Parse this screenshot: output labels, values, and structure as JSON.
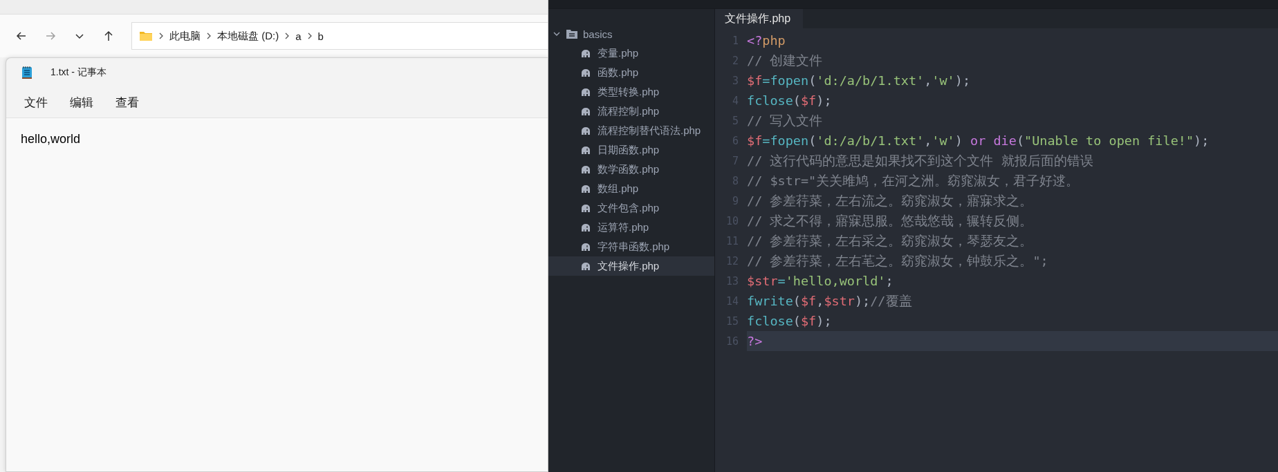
{
  "explorer": {
    "nav": [
      {
        "kind": "back",
        "disabled": false
      },
      {
        "kind": "forward",
        "disabled": true
      },
      {
        "kind": "recent",
        "disabled": false
      },
      {
        "kind": "up",
        "disabled": false
      }
    ],
    "breadcrumb": [
      "此电脑",
      "本地磁盘 (D:)",
      "a",
      "b"
    ]
  },
  "notepad": {
    "title": "1.txt - 记事本",
    "menu": [
      "文件",
      "编辑",
      "查看"
    ],
    "content": "hello,world"
  },
  "editor": {
    "tree": {
      "name": "basics",
      "expanded": true,
      "children": [
        {
          "name": "变量.php",
          "selected": false
        },
        {
          "name": "函数.php",
          "selected": false
        },
        {
          "name": "类型转换.php",
          "selected": false
        },
        {
          "name": "流程控制.php",
          "selected": false
        },
        {
          "name": "流程控制替代语法.php",
          "selected": false
        },
        {
          "name": "日期函数.php",
          "selected": false
        },
        {
          "name": "数学函数.php",
          "selected": false
        },
        {
          "name": "数组.php",
          "selected": false
        },
        {
          "name": "文件包含.php",
          "selected": false
        },
        {
          "name": "运算符.php",
          "selected": false
        },
        {
          "name": "字符串函数.php",
          "selected": false
        },
        {
          "name": "文件操作.php",
          "selected": true
        }
      ]
    },
    "tabs": [
      {
        "label": "文件操作.php",
        "selected": true
      }
    ],
    "lines": [
      {
        "number": "1",
        "current": false,
        "tokens": [
          {
            "kind": "tag",
            "text": "<?"
          },
          {
            "kind": "keyword",
            "text": "php"
          }
        ]
      },
      {
        "number": "2",
        "current": false,
        "tokens": [
          {
            "kind": "comment",
            "text": "// 创建文件"
          }
        ]
      },
      {
        "number": "3",
        "current": false,
        "tokens": [
          {
            "kind": "variable",
            "text": "$f"
          },
          {
            "kind": "operator",
            "text": "="
          },
          {
            "kind": "function",
            "text": "fopen"
          },
          {
            "kind": "plain",
            "text": "("
          },
          {
            "kind": "string",
            "text": "'d:/a/b/1.txt'"
          },
          {
            "kind": "plain",
            "text": ","
          },
          {
            "kind": "string",
            "text": "'w'"
          },
          {
            "kind": "plain",
            "text": ");"
          }
        ]
      },
      {
        "number": "4",
        "current": false,
        "tokens": [
          {
            "kind": "function",
            "text": "fclose"
          },
          {
            "kind": "plain",
            "text": "("
          },
          {
            "kind": "variable",
            "text": "$f"
          },
          {
            "kind": "plain",
            "text": ");"
          }
        ]
      },
      {
        "number": "5",
        "current": false,
        "tokens": [
          {
            "kind": "comment",
            "text": "// 写入文件"
          }
        ]
      },
      {
        "number": "6",
        "current": false,
        "tokens": [
          {
            "kind": "variable",
            "text": "$f"
          },
          {
            "kind": "operator",
            "text": "="
          },
          {
            "kind": "function",
            "text": "fopen"
          },
          {
            "kind": "plain",
            "text": "("
          },
          {
            "kind": "string",
            "text": "'d:/a/b/1.txt'"
          },
          {
            "kind": "plain",
            "text": ","
          },
          {
            "kind": "string",
            "text": "'w'"
          },
          {
            "kind": "plain",
            "text": ") "
          },
          {
            "kind": "control",
            "text": "or die"
          },
          {
            "kind": "plain",
            "text": "("
          },
          {
            "kind": "string",
            "text": "\"Unable to open file!\""
          },
          {
            "kind": "plain",
            "text": ");"
          }
        ]
      },
      {
        "number": "7",
        "current": false,
        "tokens": [
          {
            "kind": "comment",
            "text": "// 这行代码的意思是如果找不到这个文件 就报后面的错误"
          }
        ]
      },
      {
        "number": "8",
        "current": false,
        "tokens": [
          {
            "kind": "comment",
            "text": "// $str=\"关关雎鸠，在河之洲。窈窕淑女，君子好逑。"
          }
        ]
      },
      {
        "number": "9",
        "current": false,
        "tokens": [
          {
            "kind": "comment",
            "text": "// 参差荇菜，左右流之。窈窕淑女，寤寐求之。"
          }
        ]
      },
      {
        "number": "10",
        "current": false,
        "tokens": [
          {
            "kind": "comment",
            "text": "// 求之不得，寤寐思服。悠哉悠哉，辗转反侧。"
          }
        ]
      },
      {
        "number": "11",
        "current": false,
        "tokens": [
          {
            "kind": "comment",
            "text": "// 参差荇菜，左右采之。窈窕淑女，琴瑟友之。"
          }
        ]
      },
      {
        "number": "12",
        "current": false,
        "tokens": [
          {
            "kind": "comment",
            "text": "// 参差荇菜，左右芼之。窈窕淑女，钟鼓乐之。\";"
          }
        ]
      },
      {
        "number": "13",
        "current": false,
        "tokens": [
          {
            "kind": "variable",
            "text": "$str"
          },
          {
            "kind": "operator",
            "text": "="
          },
          {
            "kind": "string",
            "text": "'hello,world'"
          },
          {
            "kind": "plain",
            "text": ";"
          }
        ]
      },
      {
        "number": "14",
        "current": false,
        "tokens": [
          {
            "kind": "function",
            "text": "fwrite"
          },
          {
            "kind": "plain",
            "text": "("
          },
          {
            "kind": "variable",
            "text": "$f"
          },
          {
            "kind": "plain",
            "text": ","
          },
          {
            "kind": "variable",
            "text": "$str"
          },
          {
            "kind": "plain",
            "text": ");"
          },
          {
            "kind": "comment",
            "text": "//覆盖"
          }
        ]
      },
      {
        "number": "15",
        "current": false,
        "tokens": [
          {
            "kind": "function",
            "text": "fclose"
          },
          {
            "kind": "plain",
            "text": "("
          },
          {
            "kind": "variable",
            "text": "$f"
          },
          {
            "kind": "plain",
            "text": ");"
          }
        ]
      },
      {
        "number": "16",
        "current": true,
        "tokens": [
          {
            "kind": "tag",
            "text": "?>"
          }
        ]
      }
    ]
  }
}
